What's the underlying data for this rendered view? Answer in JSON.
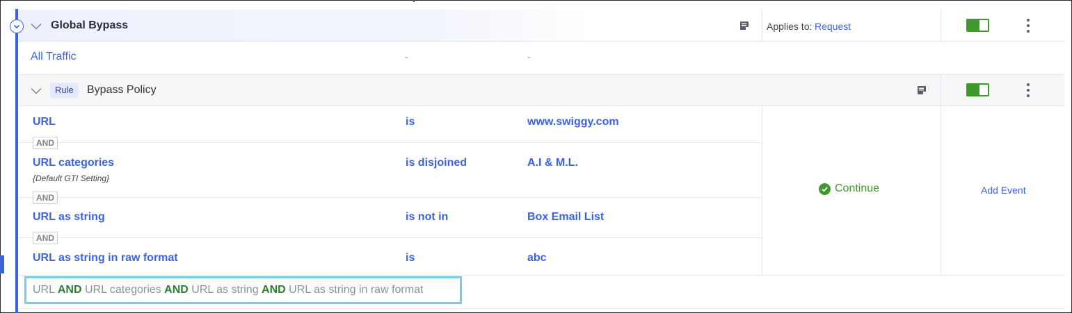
{
  "group": {
    "title": "Global Bypass",
    "applies_to_label": "Applies to:",
    "applies_to_value": "Request",
    "toggle_on": true
  },
  "traffic_row": {
    "label": "All Traffic",
    "col2": "-",
    "col3": "-"
  },
  "rule": {
    "badge": "Rule",
    "name": "Bypass Policy",
    "toggle_on": true,
    "conditions": [
      {
        "field": "URL",
        "sub": "",
        "operator": "is",
        "value": "www.swiggy.com"
      },
      {
        "field": "URL categories",
        "sub": "{Default GTI Setting}",
        "operator": "is disjoined",
        "value": "A.I & M.L."
      },
      {
        "field": "URL as string",
        "sub": "",
        "operator": "is not in",
        "value": "Box Email List"
      },
      {
        "field": "URL as string in raw format",
        "sub": "",
        "operator": "is",
        "value": "abc"
      }
    ],
    "joiner": "AND",
    "action": "Continue",
    "event_link": "Add Event",
    "summary": {
      "parts": [
        "URL",
        "AND",
        "URL categories",
        "AND",
        "URL as string",
        "AND",
        "URL as string in raw format"
      ]
    }
  },
  "colors": {
    "accent_blue": "#3b63e0",
    "success_green": "#3f9a2e",
    "summary_border": "#74d0e8"
  }
}
